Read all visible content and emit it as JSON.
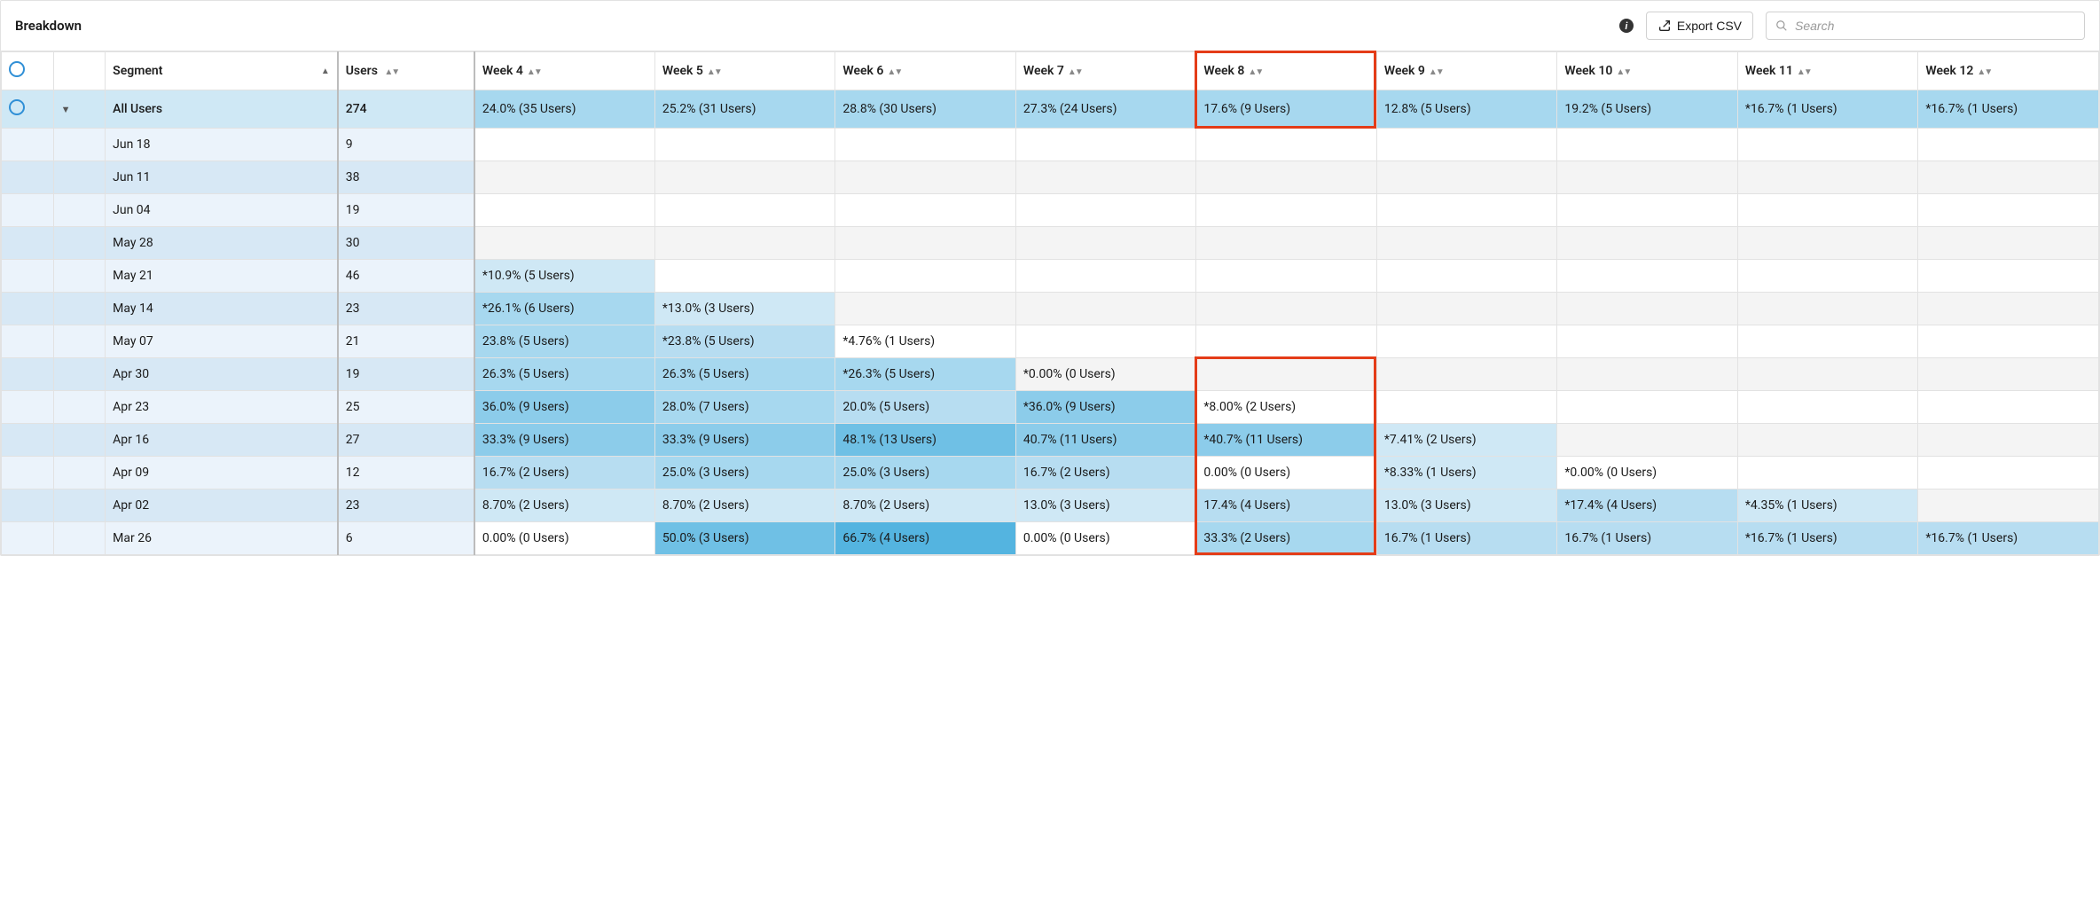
{
  "header": {
    "title": "Breakdown",
    "export_label": "Export CSV",
    "search_placeholder": "Search"
  },
  "columns": {
    "segment": "Segment",
    "users": "Users",
    "weeks": [
      "Week 4",
      "Week 5",
      "Week 6",
      "Week 7",
      "Week 8",
      "Week 9",
      "Week 10",
      "Week 11",
      "Week 12"
    ]
  },
  "all_users_row": {
    "label": "All Users",
    "users": "274",
    "cells": [
      "24.0% (35 Users)",
      "25.2% (31 Users)",
      "28.8% (30 Users)",
      "27.3% (24 Users)",
      "17.6% (9 Users)",
      "12.8% (5 Users)",
      "19.2% (5 Users)",
      "*16.7% (1 Users)",
      "*16.7% (1 Users)"
    ]
  },
  "rows": [
    {
      "label": "Jun 18",
      "users": "9",
      "cells": [
        "",
        "",
        "",
        "",
        "",
        "",
        "",
        "",
        ""
      ],
      "shades": [
        "",
        "",
        "",
        "",
        "",
        "",
        "",
        "",
        ""
      ]
    },
    {
      "label": "Jun 11",
      "users": "38",
      "cells": [
        "",
        "",
        "",
        "",
        "",
        "",
        "",
        "",
        ""
      ],
      "shades": [
        "",
        "",
        "",
        "",
        "",
        "",
        "",
        "",
        ""
      ]
    },
    {
      "label": "Jun 04",
      "users": "19",
      "cells": [
        "",
        "",
        "",
        "",
        "",
        "",
        "",
        "",
        ""
      ],
      "shades": [
        "",
        "",
        "",
        "",
        "",
        "",
        "",
        "",
        ""
      ]
    },
    {
      "label": "May 28",
      "users": "30",
      "cells": [
        "",
        "",
        "",
        "",
        "",
        "",
        "",
        "",
        ""
      ],
      "shades": [
        "",
        "",
        "",
        "",
        "",
        "",
        "",
        "",
        ""
      ]
    },
    {
      "label": "May 21",
      "users": "46",
      "cells": [
        "*10.9% (5 Users)",
        "",
        "",
        "",
        "",
        "",
        "",
        "",
        ""
      ],
      "shades": [
        "h0",
        "",
        "",
        "",
        "",
        "",
        "",
        "",
        ""
      ]
    },
    {
      "label": "May 14",
      "users": "23",
      "cells": [
        "*26.1% (6 Users)",
        "*13.0% (3 Users)",
        "",
        "",
        "",
        "",
        "",
        "",
        ""
      ],
      "shades": [
        "h2",
        "h0",
        "",
        "",
        "",
        "",
        "",
        "",
        ""
      ]
    },
    {
      "label": "May 07",
      "users": "21",
      "cells": [
        "23.8% (5 Users)",
        "*23.8% (5 Users)",
        "*4.76% (1 Users)",
        "",
        "",
        "",
        "",
        "",
        ""
      ],
      "shades": [
        "h2",
        "h1",
        "",
        "",
        "",
        "",
        "",
        "",
        ""
      ]
    },
    {
      "label": "Apr 30",
      "users": "19",
      "cells": [
        "26.3% (5 Users)",
        "26.3% (5 Users)",
        "*26.3% (5 Users)",
        "*0.00% (0 Users)",
        "",
        "",
        "",
        "",
        ""
      ],
      "shades": [
        "h2",
        "h2",
        "h2",
        "",
        "",
        "",
        "",
        "",
        ""
      ]
    },
    {
      "label": "Apr 23",
      "users": "25",
      "cells": [
        "36.0% (9 Users)",
        "28.0% (7 Users)",
        "20.0% (5 Users)",
        "*36.0% (9 Users)",
        "*8.00% (2 Users)",
        "",
        "",
        "",
        ""
      ],
      "shades": [
        "h3",
        "h2",
        "h1",
        "h3",
        "",
        "",
        "",
        "",
        ""
      ]
    },
    {
      "label": "Apr 16",
      "users": "27",
      "cells": [
        "33.3% (9 Users)",
        "33.3% (9 Users)",
        "48.1% (13 Users)",
        "40.7% (11 Users)",
        "*40.7% (11 Users)",
        "*7.41% (2 Users)",
        "",
        "",
        ""
      ],
      "shades": [
        "h3",
        "h3",
        "h4",
        "h3",
        "h3",
        "h0",
        "",
        "",
        ""
      ]
    },
    {
      "label": "Apr 09",
      "users": "12",
      "cells": [
        "16.7% (2 Users)",
        "25.0% (3 Users)",
        "25.0% (3 Users)",
        "16.7% (2 Users)",
        "0.00% (0 Users)",
        "*8.33% (1 Users)",
        "*0.00% (0 Users)",
        "",
        ""
      ],
      "shades": [
        "h1",
        "h2",
        "h2",
        "h1",
        "",
        "h0",
        "",
        "",
        ""
      ]
    },
    {
      "label": "Apr 02",
      "users": "23",
      "cells": [
        "8.70% (2 Users)",
        "8.70% (2 Users)",
        "8.70% (2 Users)",
        "13.0% (3 Users)",
        "17.4% (4 Users)",
        "13.0% (3 Users)",
        "*17.4% (4 Users)",
        "*4.35% (1 Users)",
        ""
      ],
      "shades": [
        "h0",
        "h0",
        "h0",
        "h0",
        "h1",
        "h0",
        "h1",
        "h0",
        ""
      ]
    },
    {
      "label": "Mar 26",
      "users": "6",
      "cells": [
        "0.00% (0 Users)",
        "50.0% (3 Users)",
        "66.7% (4 Users)",
        "0.00% (0 Users)",
        "33.3% (2 Users)",
        "16.7% (1 Users)",
        "16.7% (1 Users)",
        "*16.7% (1 Users)",
        "*16.7% (1 Users)"
      ],
      "shades": [
        "",
        "h4",
        "h5",
        "",
        "h2",
        "h1",
        "h1",
        "h1",
        "h1"
      ]
    }
  ]
}
